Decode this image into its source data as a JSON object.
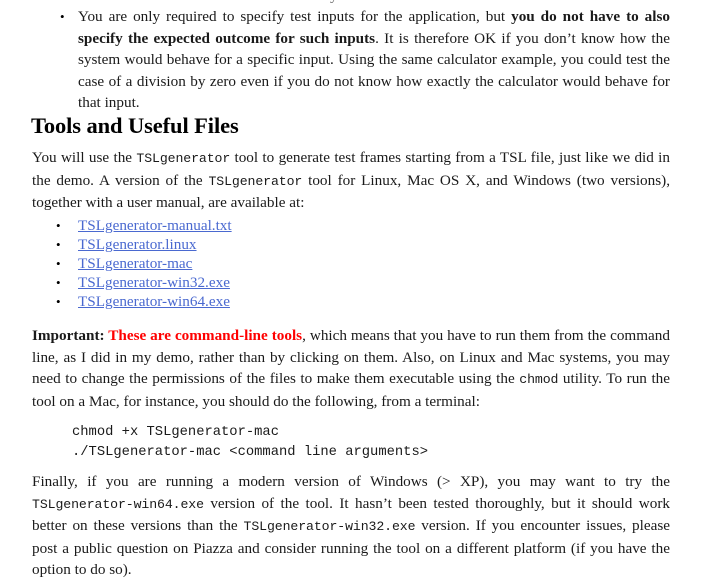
{
  "document": {
    "top_clipped_fragment": "y",
    "intro_bullet": {
      "bullet_glyph": "•",
      "segments": [
        {
          "text": "You are only required to specify test inputs for the application, but ",
          "style": "normal"
        },
        {
          "text": "you do not have to also specify the expected outcome for such inputs",
          "style": "bold"
        },
        {
          "text": ". It is therefore OK if you don’t know how the system would behave for a specific input. Using the same calculator example, you could test the case of a division by zero even if you do not know how exactly the calculator would behave for that input.",
          "style": "normal"
        }
      ]
    },
    "heading": "Tools and Useful Files",
    "intro_paragraph": {
      "part1": "You will use the ",
      "code1": "TSLgenerator",
      "part2": " tool to generate test frames starting from a TSL file, just like we did in the demo. A version of the ",
      "code2": "TSLgenerator",
      "part3": " tool for Linux, Mac OS X, and Windows (two versions), together with a user manual, are available at:"
    },
    "file_links": {
      "bullet_glyph": "•",
      "items": [
        {
          "label": "TSLgenerator-manual.txt"
        },
        {
          "label": "TSLgenerator.linux"
        },
        {
          "label": "TSLgenerator-mac"
        },
        {
          "label": "TSLgenerator-win32.exe"
        },
        {
          "label": "TSLgenerator-win64.exe"
        }
      ]
    },
    "important_paragraph": {
      "label": "Important:",
      "highlight": " These are command-line tools",
      "part1": ", which means that you have to run them from the command line, as I did in my demo, rather than by clicking on them. Also, on Linux and Mac systems, you may need to change the permissions of the files to make them executable using the ",
      "code1": "chmod",
      "part2": " utility. To run the tool on a Mac, for instance, you should do the following, from a terminal:"
    },
    "code_block": {
      "line1": "chmod +x TSLgenerator-mac",
      "line2": "./TSLgenerator-mac <command line arguments>"
    },
    "closing_paragraph": {
      "part1": "Finally, if you are running a modern version of Windows (> XP), you may want to try the ",
      "code1": "TSLgenerator-win64.exe",
      "part2": " version of the tool. It hasn’t been  tested thoroughly, but it should work better on these versions than the ",
      "code2": "TSLgenerator-win32.exe",
      "part3": " version. If you encounter issues, please post a public question on Piazza and consider running the tool on a different platform (if you have the option to do so)."
    }
  },
  "colors": {
    "link": "#4a69d0",
    "highlight": "#ff0000",
    "text": "#1a1a1a",
    "background": "#ffffff"
  }
}
